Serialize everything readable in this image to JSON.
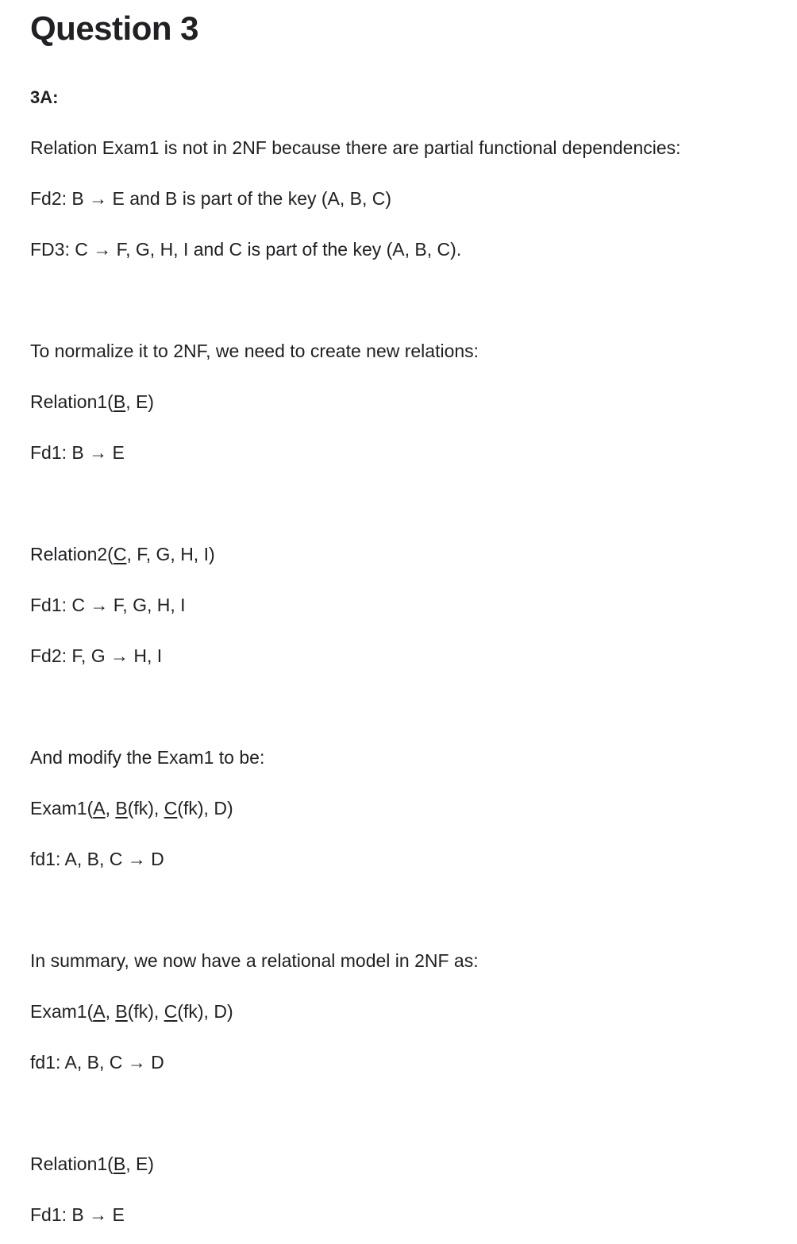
{
  "title": "Question 3",
  "subhead": "3A:",
  "para1": {
    "text": "Relation Exam1 is not in 2NF because there are partial functional dependencies:",
    "fd2": "Fd2: B → E and B is part of the key (A, B, C)",
    "fd3": "FD3: C → F, G, H, I and C is part of the key (A, B, C)."
  },
  "para2": {
    "text": "To normalize it to 2NF, we need to create new relations:"
  },
  "relation1": {
    "prefix": "Relation1(",
    "key": "B",
    "suffix": ", E)",
    "fd1": "Fd1: B → E"
  },
  "relation2": {
    "prefix": "Relation2(",
    "key": "C",
    "suffix": ", F, G, H, I)",
    "fd1": "Fd1: C → F, G, H, I",
    "fd2": "Fd2: F, G → H, I"
  },
  "para3": {
    "text": "And modify the Exam1 to be:"
  },
  "exam1": {
    "prefix": "Exam1(",
    "a": "A",
    "sep1": ", ",
    "b": "B",
    "sep2": "(fk), ",
    "c": "C",
    "suffix": "(fk), D)",
    "fd1": "fd1: A, B, C → D"
  },
  "summary": {
    "text": "In summary, we now have a relational model in 2NF as:",
    "exam1": {
      "prefix": "Exam1(",
      "a": "A",
      "sep1": ", ",
      "b": "B",
      "sep2": "(fk), ",
      "c": "C",
      "suffix": "(fk), D)",
      "fd1": "fd1: A, B, C → D"
    },
    "relation1": {
      "prefix": "Relation1(",
      "key": "B",
      "suffix": ", E)",
      "fd1": "Fd1: B → E"
    }
  }
}
